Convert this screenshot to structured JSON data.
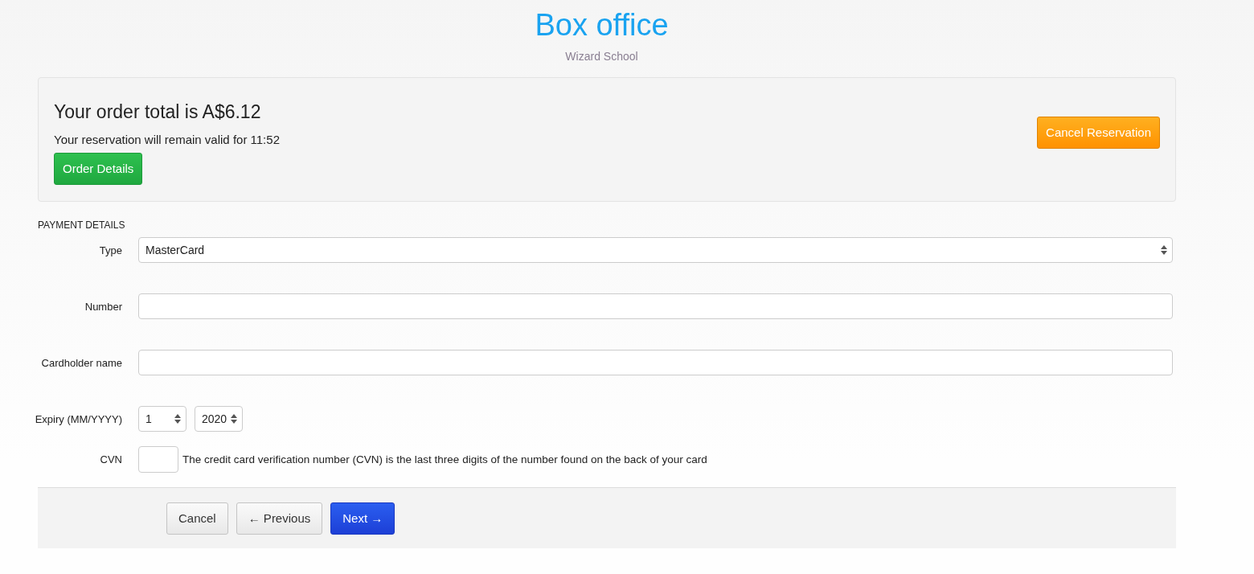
{
  "header": {
    "title": "Box office",
    "subtitle": "Wizard School"
  },
  "order_summary": {
    "total": "Your order total is A$6.12",
    "validity": "Your reservation will remain valid for 11:52",
    "details_button": "Order Details",
    "cancel_button": "Cancel Reservation"
  },
  "payment": {
    "heading": "PAYMENT DETAILS",
    "fields": [
      {
        "kind": "select",
        "label": "Type",
        "value": "MasterCard"
      },
      {
        "kind": "text",
        "label": "Number"
      },
      {
        "kind": "text",
        "label": "Cardholder name"
      },
      {
        "kind": "expiry",
        "label": "Expiry (MM/YYYY)",
        "month": "1",
        "year": "2020"
      },
      {
        "kind": "cvn",
        "label": "CVN",
        "help": "The credit card verification number (CVN) is the last three digits of the number found on the back of your card"
      }
    ]
  },
  "footer_buttons": [
    {
      "label": "Cancel",
      "kind": "default"
    },
    {
      "label": "← Previous",
      "kind": "default"
    },
    {
      "label": "Next →",
      "kind": "primary"
    }
  ]
}
